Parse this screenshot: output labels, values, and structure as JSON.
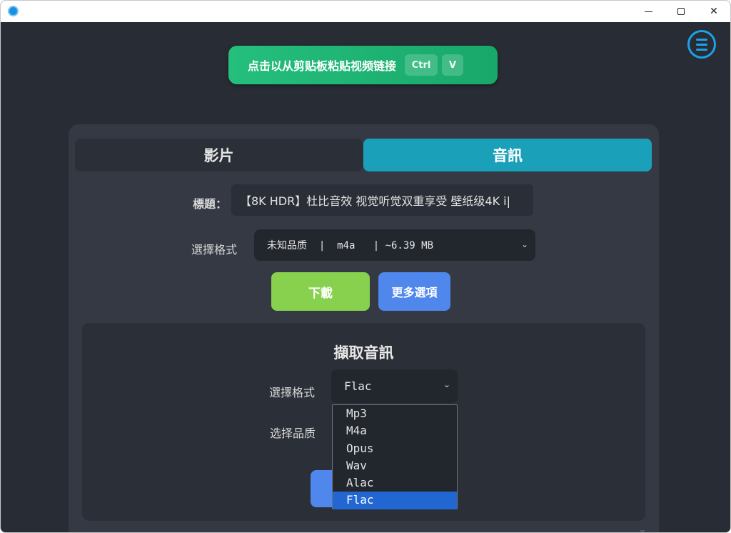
{
  "window": {
    "minimize_glyph": "",
    "close_glyph": "✕"
  },
  "toolbar": {
    "paste_label": "点击以从剪贴板粘贴视频链接",
    "key_ctrl": "Ctrl",
    "key_v": "V"
  },
  "tabs": [
    {
      "label": "影片",
      "active": false
    },
    {
      "label": "音訊",
      "active": true
    }
  ],
  "info": {
    "title_label": "標題：",
    "title_value": "【8K HDR】杜比音效 视觉听觉双重享受 壁纸级4K i|",
    "format_label": "選擇格式",
    "format_value": "未知品质  |  m4a   | ~6.39 MB"
  },
  "actions": {
    "download_label": "下載",
    "more_label": "更多選項"
  },
  "extract": {
    "title": "擷取音訊",
    "format_label": "選擇格式",
    "format_value": "Flac",
    "quality_label": "选择品质",
    "options": [
      "Mp3",
      "M4a",
      "Opus",
      "Wav",
      "Alac",
      "Flac"
    ],
    "selected_option": "Flac"
  },
  "colors": {
    "accent_green": "#25bf7d",
    "tab_active": "#1aa0b8",
    "download": "#87d14e",
    "more": "#4f87ec",
    "menu_icon": "#1da1e8",
    "selected_option": "#2166d1"
  },
  "icons": [
    "app-icon",
    "menu-icon",
    "chevron-down-icon",
    "minimize-icon",
    "maximize-icon",
    "close-icon"
  ]
}
